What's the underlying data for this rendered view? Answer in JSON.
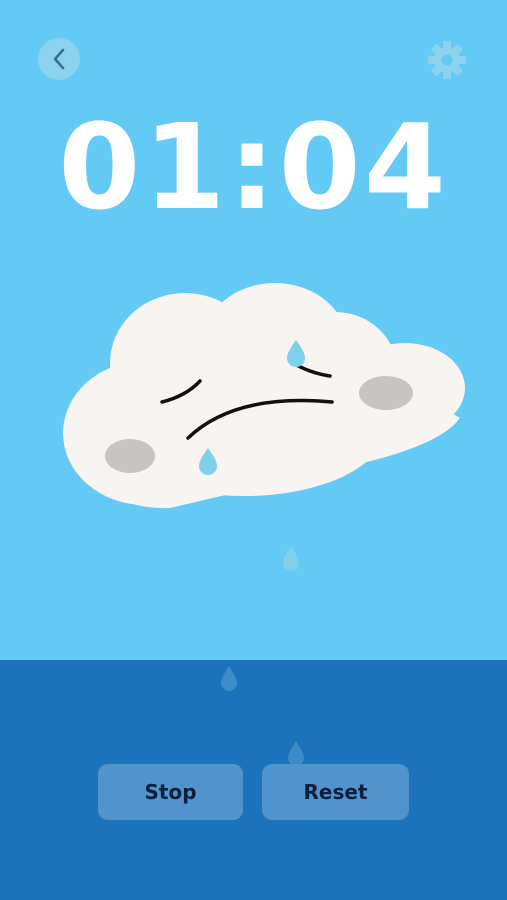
{
  "timer": {
    "display": "01:04"
  },
  "toolbar": {
    "back_icon": "chevron-left-icon",
    "settings_icon": "gear-icon"
  },
  "controls": {
    "stop_label": "Stop",
    "reset_label": "Reset"
  },
  "colors": {
    "sky": "#63C9F5",
    "water": "#1C73BC",
    "button": "#5093CD",
    "cloud": "#F7F4F1",
    "raindrop": "#7FD0EA"
  }
}
